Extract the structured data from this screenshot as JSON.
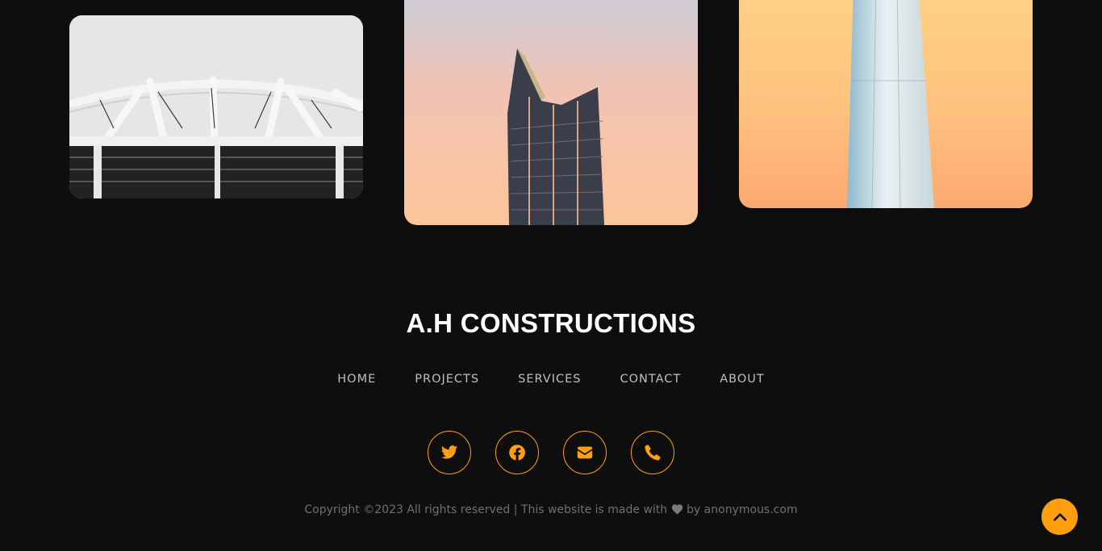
{
  "gallery": {
    "images": [
      {
        "name": "stadium-image"
      },
      {
        "name": "tower-image"
      },
      {
        "name": "pillar-image"
      }
    ]
  },
  "footer": {
    "brand": "A.H CONSTRUCTIONS",
    "nav": [
      "HOME",
      "PROJECTS",
      "SERVICES",
      "CONTACT",
      "ABOUT"
    ],
    "social_icons": [
      "twitter-icon",
      "facebook-icon",
      "envelope-icon",
      "phone-icon"
    ],
    "copyright_before": "Copyright ©2023 All rights reserved | This website is made with",
    "copyright_after": "by anonymous.com",
    "accent_color": "#ff9f10"
  },
  "scroll_top_icon": "chevron-up-icon"
}
